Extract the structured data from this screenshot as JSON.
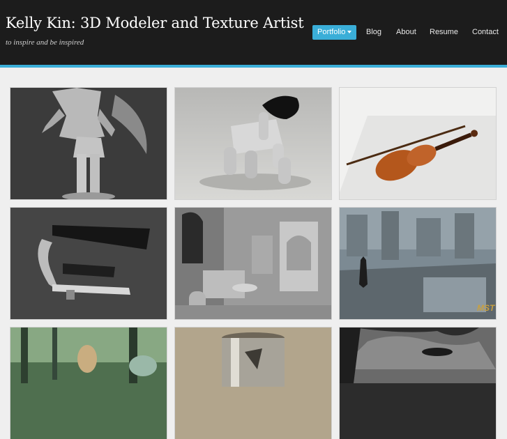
{
  "site": {
    "title": "Kelly Kin: 3D Modeler and Texture Artist",
    "tagline": "to inspire and be inspired"
  },
  "nav": {
    "items": [
      {
        "label": "Portfolio",
        "active": true,
        "has_dropdown": true
      },
      {
        "label": "Blog"
      },
      {
        "label": "About"
      },
      {
        "label": "Resume"
      },
      {
        "label": "Contact"
      }
    ]
  },
  "colors": {
    "header_bg": "#1c1c1c",
    "accent": "#3aaed8",
    "page_bg": "#efefef"
  },
  "gallery": {
    "tiles": [
      {
        "subject": "character-sculpt-render"
      },
      {
        "subject": "robot-dog-render"
      },
      {
        "subject": "violin-render"
      },
      {
        "subject": "guitar-capo-render"
      },
      {
        "subject": "interior-room-render"
      },
      {
        "subject": "city-rooftop-render",
        "overlay_text": "MST"
      },
      {
        "subject": "forest-scene-render"
      },
      {
        "subject": "metal-can-render"
      },
      {
        "subject": "face-closeup-render"
      }
    ]
  }
}
